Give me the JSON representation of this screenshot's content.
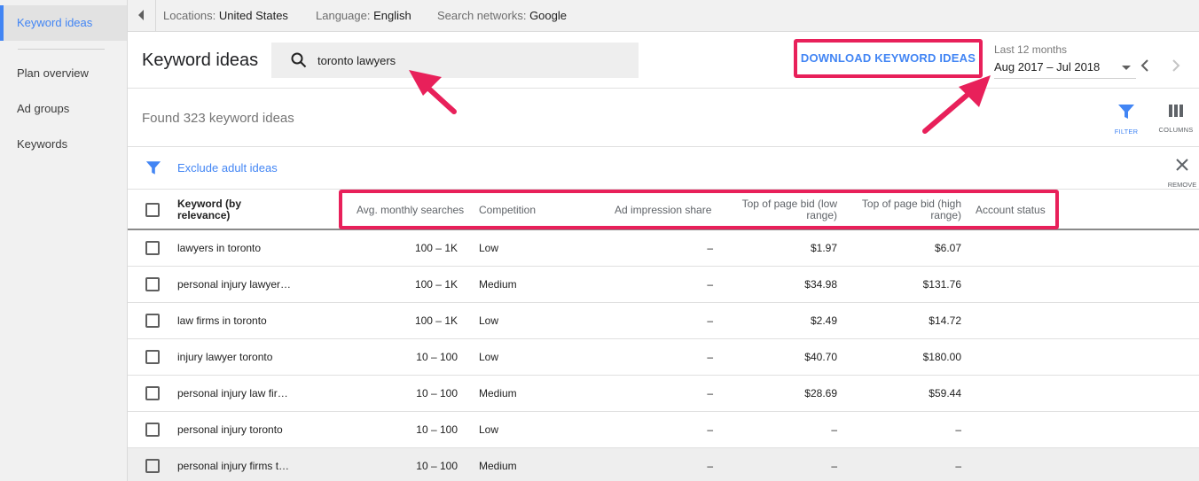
{
  "sidebar": {
    "items": [
      {
        "label": "Keyword ideas",
        "active": true
      },
      {
        "label": "Plan overview",
        "active": false
      },
      {
        "label": "Ad groups",
        "active": false
      },
      {
        "label": "Keywords",
        "active": false
      }
    ]
  },
  "topbar": {
    "locations_label": "Locations:",
    "locations_value": "United States",
    "language_label": "Language:",
    "language_value": "English",
    "networks_label": "Search networks:",
    "networks_value": "Google"
  },
  "header": {
    "title": "Keyword ideas",
    "search_value": "toronto lawyers",
    "download_label": "DOWNLOAD KEYWORD IDEAS",
    "date_label": "Last 12 months",
    "date_value": "Aug 2017 – Jul 2018"
  },
  "results": {
    "found_text": "Found 323 keyword ideas",
    "filter_label": "FILTER",
    "columns_label": "COLUMNS"
  },
  "filterbar": {
    "exclude_label": "Exclude adult ideas",
    "remove_label": "REMOVE"
  },
  "table": {
    "headers": {
      "keyword": "Keyword (by relevance)",
      "avg": "Avg. monthly searches",
      "competition": "Competition",
      "impression": "Ad impression share",
      "low_bid": "Top of page bid (low range)",
      "high_bid": "Top of page bid (high range)",
      "status": "Account status"
    },
    "rows": [
      {
        "keyword": "lawyers in toronto",
        "avg": "100 – 1K",
        "competition": "Low",
        "impression": "–",
        "low": "$1.97",
        "high": "$6.07"
      },
      {
        "keyword": "personal injury lawyer…",
        "avg": "100 – 1K",
        "competition": "Medium",
        "impression": "–",
        "low": "$34.98",
        "high": "$131.76"
      },
      {
        "keyword": "law firms in toronto",
        "avg": "100 – 1K",
        "competition": "Low",
        "impression": "–",
        "low": "$2.49",
        "high": "$14.72"
      },
      {
        "keyword": "injury lawyer toronto",
        "avg": "10 – 100",
        "competition": "Low",
        "impression": "–",
        "low": "$40.70",
        "high": "$180.00"
      },
      {
        "keyword": "personal injury law fir…",
        "avg": "10 – 100",
        "competition": "Medium",
        "impression": "–",
        "low": "$28.69",
        "high": "$59.44"
      },
      {
        "keyword": "personal injury toronto",
        "avg": "10 – 100",
        "competition": "Low",
        "impression": "–",
        "low": "–",
        "high": "–"
      },
      {
        "keyword": "personal injury firms t…",
        "avg": "10 – 100",
        "competition": "Medium",
        "impression": "–",
        "low": "–",
        "high": "–"
      }
    ]
  },
  "colors": {
    "accent": "#4285f4",
    "highlight": "#e8205a",
    "sidebar_bg": "#f1f1f1"
  },
  "icons": [
    "chevron-left-icon",
    "search-icon",
    "dropdown-caret-icon",
    "chevron-right-icon",
    "filter-icon",
    "columns-icon",
    "close-icon",
    "checkbox-icon"
  ]
}
